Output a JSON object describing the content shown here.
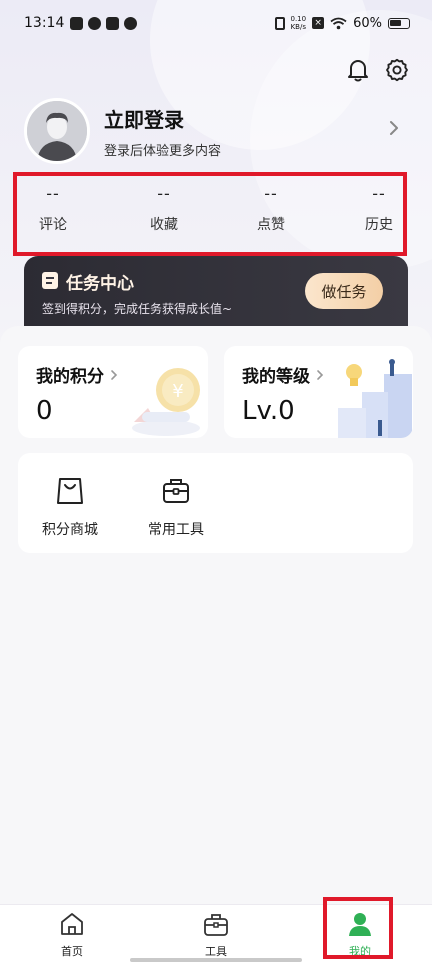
{
  "status_bar": {
    "time": "13:14",
    "net_speed_value": "0.10",
    "net_speed_unit": "KB/s",
    "battery": "60%"
  },
  "profile": {
    "login_title": "立即登录",
    "login_subtitle": "登录后体验更多内容"
  },
  "stats": [
    {
      "value": "--",
      "label": "评论"
    },
    {
      "value": "--",
      "label": "收藏"
    },
    {
      "value": "--",
      "label": "点赞"
    },
    {
      "value": "--",
      "label": "历史"
    }
  ],
  "task_center": {
    "title": "任务中心",
    "subtitle": "签到得积分，完成任务获得成长值~",
    "button": "做任务"
  },
  "points_card": {
    "title": "我的积分",
    "value": "0",
    "coin_symbol": "¥"
  },
  "level_card": {
    "title": "我的等级",
    "value": "Lv.0"
  },
  "tools": [
    {
      "label": "积分商城",
      "icon": "shopping-bag-icon"
    },
    {
      "label": "常用工具",
      "icon": "toolbox-icon"
    }
  ],
  "bottom_nav": [
    {
      "label": "首页",
      "icon": "home-icon"
    },
    {
      "label": "工具",
      "icon": "toolbox-icon"
    },
    {
      "label": "我的",
      "icon": "person-icon",
      "active": true
    }
  ],
  "colors": {
    "accent_green": "#2fb055",
    "highlight_red": "#e0192a",
    "task_bg": "#2c2b33",
    "task_button": "#f3cfa6"
  }
}
